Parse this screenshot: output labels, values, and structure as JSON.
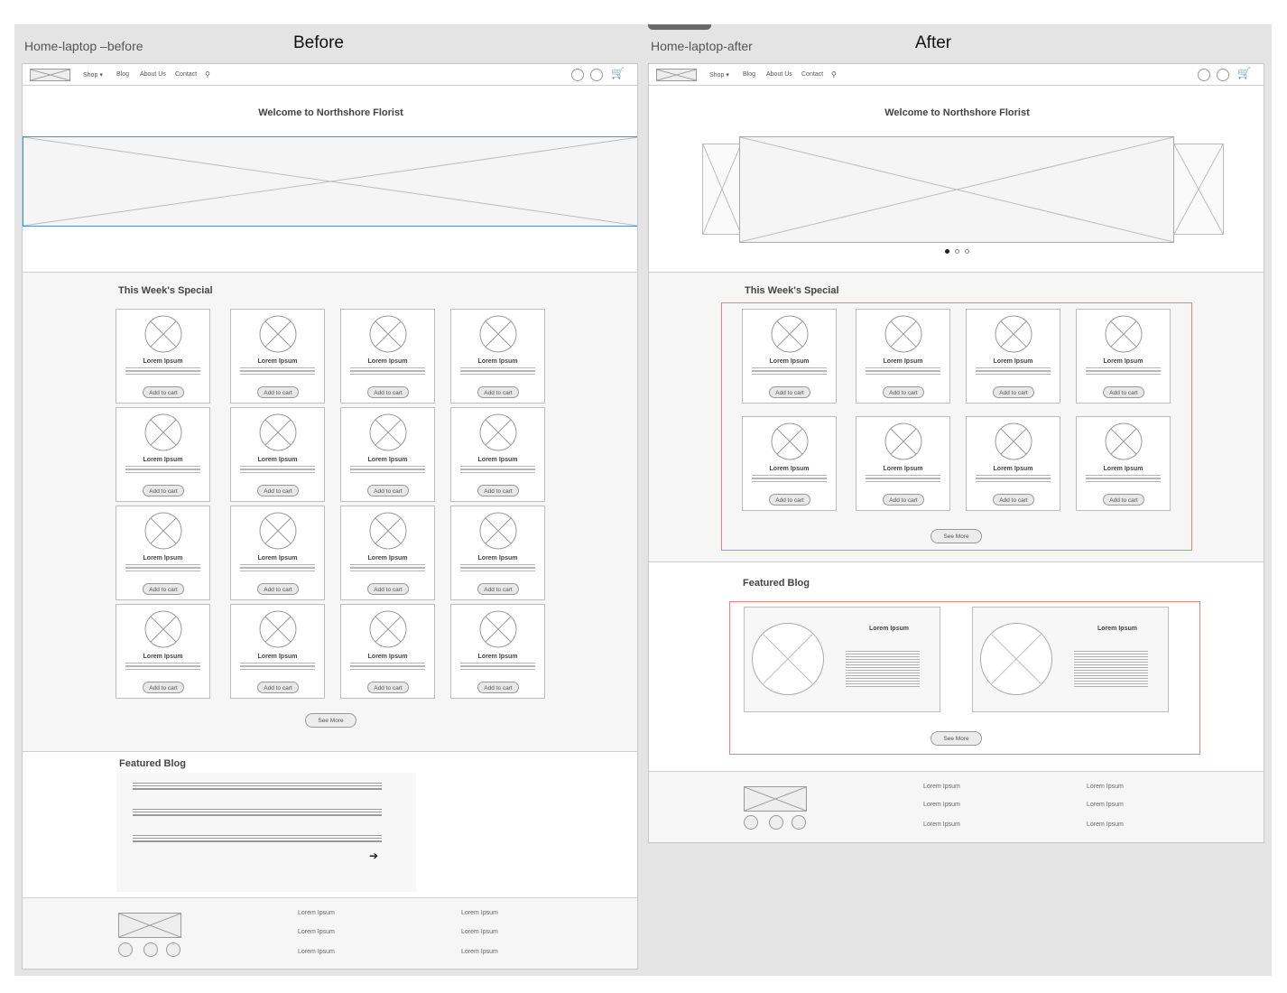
{
  "frames": {
    "before_name": "Home-laptop –before",
    "after_name": "Home-laptop-after",
    "before_heading": "Before",
    "after_heading": "After"
  },
  "nav": {
    "shop": "Shop",
    "blog": "Blog",
    "about": "About Us",
    "contact": "Contact"
  },
  "hero": {
    "welcome": "Welcome to Northshore Florist"
  },
  "specials": {
    "title": "This Week's Special",
    "product_title": "Lorem Ipsum",
    "add_to_cart": "Add to cart",
    "see_more": "See More",
    "before_count": 16,
    "after_count": 8
  },
  "blog": {
    "title": "Featured Blog",
    "post_title": "Lorem Ipsum",
    "see_more": "See More"
  },
  "footer": {
    "links": [
      "Lorem Ipsum",
      "Lorem Ipsum",
      "Lorem Ipsum",
      "Lorem Ipsum",
      "Lorem Ipsum",
      "Lorem Ipsum"
    ]
  },
  "colors": {
    "selection_blue": "#4a90d9",
    "annotation_red": "#f08080"
  },
  "icons": [
    "search-icon",
    "cart-icon",
    "chevron-down-icon",
    "arrow-right-icon"
  ]
}
